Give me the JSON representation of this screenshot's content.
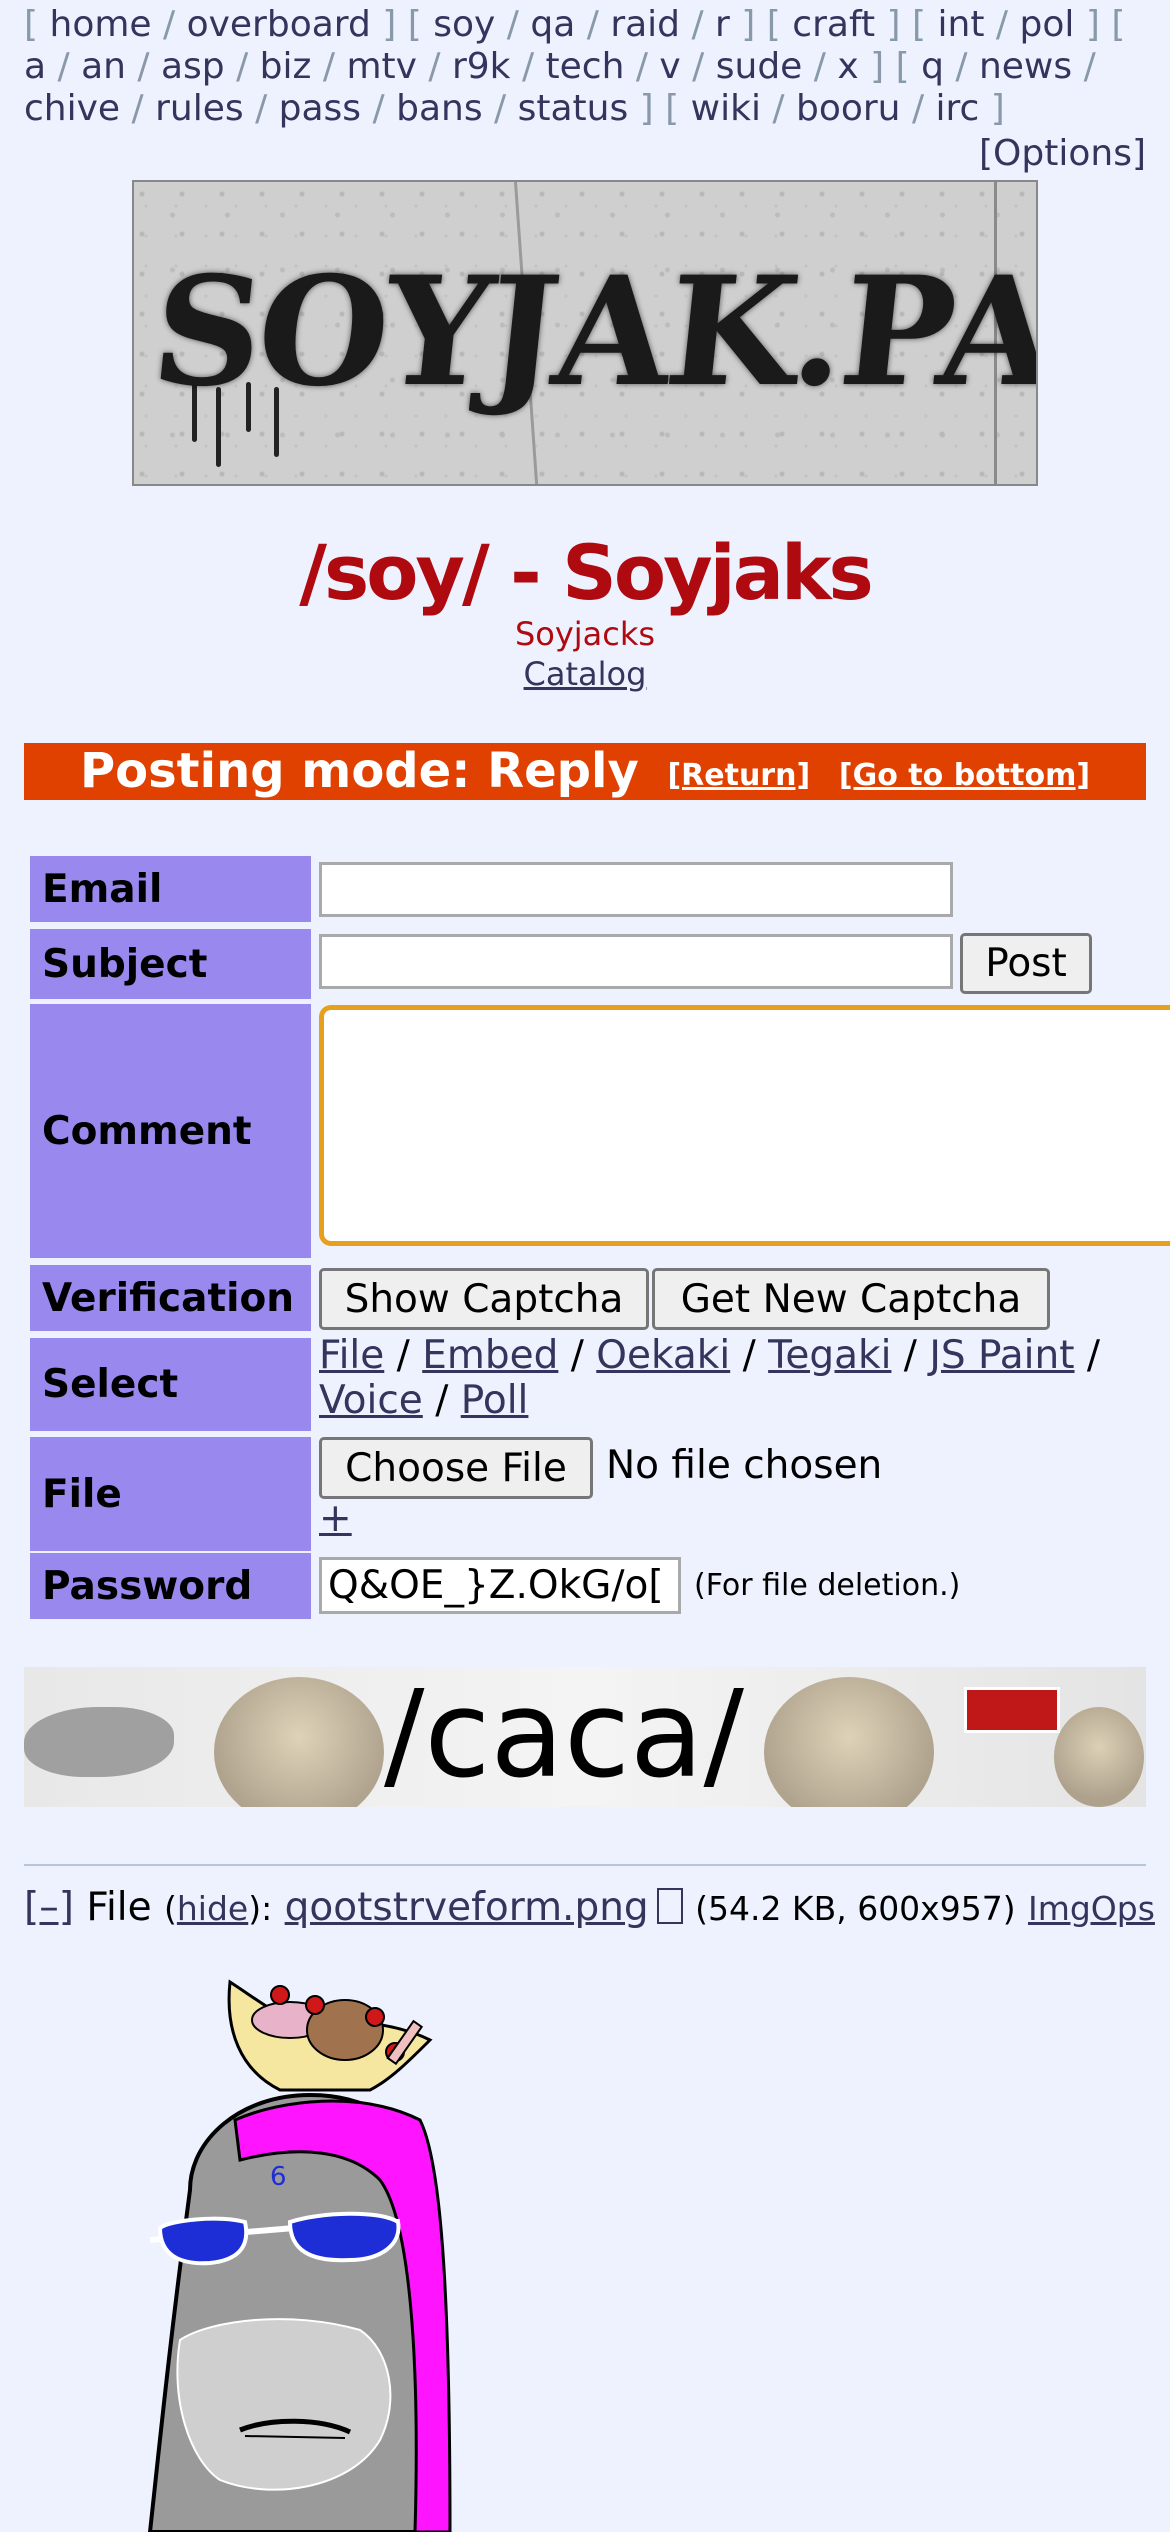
{
  "boardlist": {
    "groups": [
      [
        "home",
        "overboard"
      ],
      [
        "soy",
        "qa",
        "raid",
        "r"
      ],
      [
        "craft"
      ],
      [
        "int",
        "pol"
      ],
      [
        "a",
        "an",
        "asp",
        "biz",
        "mtv",
        "r9k",
        "tech",
        "v",
        "sude",
        "x"
      ],
      [
        "q",
        "news",
        "chive",
        "rules",
        "pass",
        "bans",
        "status"
      ],
      [
        "wiki",
        "booru",
        "irc"
      ]
    ],
    "options_label": "[Options]"
  },
  "banner": {
    "text": "SOYJAK.PARTY"
  },
  "board": {
    "title": "/soy/ - Soyjaks",
    "subtitle": "Soyjacks",
    "catalog_link": "Catalog"
  },
  "posting_mode": {
    "title": "Posting mode: Reply",
    "return_link": "[Return]",
    "bottom_link": "[Go to bottom]"
  },
  "form": {
    "email_label": "Email",
    "email_value": "",
    "subject_label": "Subject",
    "subject_value": "",
    "post_button": "Post",
    "comment_label": "Comment",
    "comment_value": "",
    "verification_label": "Verification",
    "show_captcha": "Show Captcha",
    "get_new_captcha": "Get New Captcha",
    "select_label": "Select",
    "select_links": [
      "File",
      "Embed",
      "Oekaki",
      "Tegaki",
      "JS Paint",
      "Voice",
      "Poll"
    ],
    "file_label": "File",
    "choose_file": "Choose File",
    "no_file": "No file chosen",
    "plus_link": "+",
    "password_label": "Password",
    "password_value": "Q&OE_}Z.OkG/o[",
    "password_note": "(For file deletion.)"
  },
  "ad_banner": {
    "text": "/caca/"
  },
  "post": {
    "toggle": "[–]",
    "file_prefix": "File",
    "hide_link": "hide",
    "filename": "qootstrveform.png",
    "meta": "(54.2 KB, 600x957)",
    "imgops": "ImgOps"
  },
  "colors": {
    "background": "#eef2ff",
    "title_red": "#af0a0f",
    "posting_bar": "#e04000",
    "label_purple": "#9988ee",
    "link": "#34345c",
    "comment_focus": "#e6a01e"
  }
}
